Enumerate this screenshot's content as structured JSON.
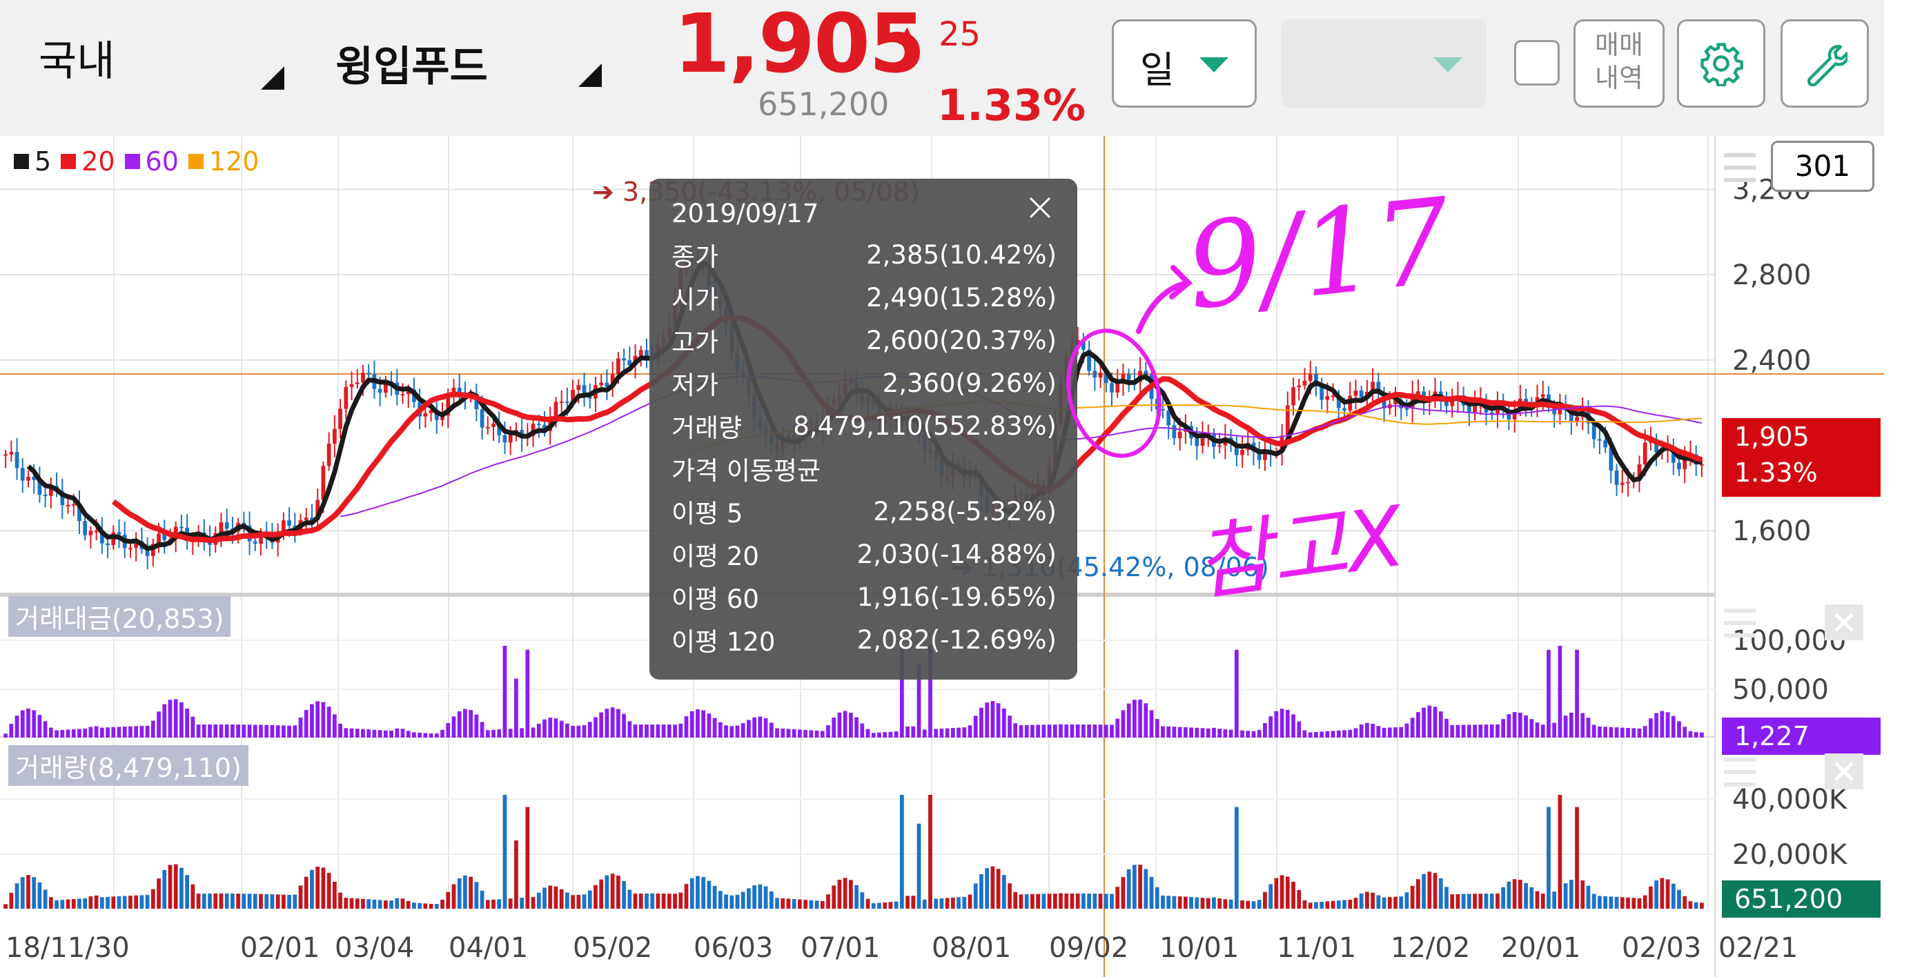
{
  "header": {
    "market": "국내",
    "stock_name": "윙입푸드",
    "price": "1,905",
    "change_arrow": "▲",
    "change": "25",
    "volume": "651,200",
    "change_pct": "1.33%",
    "period_label": "일",
    "trade_history_line1": "매매",
    "trade_history_line2": "내역",
    "count_box": "301"
  },
  "colors": {
    "up": "#e01a22",
    "down": "#1a73c8",
    "ma5": "#1a1a1a",
    "ma20": "#e8191f",
    "ma60": "#a020f0",
    "ma120": "#f5a000",
    "accent_green": "#1aa27f",
    "annotation": "#e81ff2",
    "amount_bar": "#8a1df2",
    "volume_tag": "#0b7a5a"
  },
  "legend": [
    {
      "label": "5",
      "color": "#1a1a1a"
    },
    {
      "label": "20",
      "color": "#e8191f"
    },
    {
      "label": "60",
      "color": "#a020f0"
    },
    {
      "label": "120",
      "color": "#f5a000"
    }
  ],
  "chart_data": {
    "type": "candlestick",
    "x_ticks": [
      "18/11/30",
      "02/01",
      "03/04",
      "04/01",
      "05/02",
      "06/03",
      "07/01",
      "08/01",
      "09/02",
      "10/01",
      "11/01",
      "12/02",
      "20/01",
      "02/03",
      "02/21"
    ],
    "y_ticks": [
      "3,200",
      "2,800",
      "2,400",
      "1,600"
    ],
    "ylim": [
      1300,
      3450
    ],
    "grid": true,
    "ma_lines": [
      "5",
      "20",
      "60",
      "120"
    ],
    "high_marker": "➔ 3,350(-43.13%, 05/08)",
    "low_marker": "➔ 1,310(45.42%, 08/06)",
    "current_price": "1,905",
    "current_pct": "1.33%",
    "approx_close_series": [
      1930,
      1850,
      1750,
      1650,
      1550,
      1520,
      1560,
      1570,
      1590,
      1600,
      1580,
      1590,
      1650,
      2100,
      2350,
      2280,
      2200,
      2150,
      2250,
      2120,
      2000,
      2100,
      2200,
      2250,
      2350,
      2400,
      2500,
      2900,
      2750,
      2300,
      2050,
      2000,
      2100,
      2280,
      2200,
      2150,
      2050,
      1900,
      1850,
      1700,
      1720,
      1800,
      2500,
      2330,
      2300,
      2300,
      2100,
      2000,
      2050,
      1950,
      1950,
      2300,
      2250,
      2200,
      2250,
      2200,
      2200,
      2250,
      2150,
      2180,
      2180,
      2200,
      2150,
      2000,
      1800,
      2000,
      1950,
      1905
    ]
  },
  "tooltip": {
    "date": "2019/09/17",
    "rows": [
      {
        "label": "종가",
        "value": "2,385(10.42%)"
      },
      {
        "label": "시가",
        "value": "2,490(15.28%)"
      },
      {
        "label": "고가",
        "value": "2,600(20.37%)"
      },
      {
        "label": "저가",
        "value": "2,360(9.26%)"
      },
      {
        "label": "거래량",
        "value": "8,479,110(552.83%)"
      },
      {
        "label": "가격 이동평균",
        "value": ""
      },
      {
        "label": "이평 5",
        "value": "2,258(-5.32%)"
      },
      {
        "label": "이평 20",
        "value": "2,030(-14.88%)"
      },
      {
        "label": "이평 60",
        "value": "1,916(-19.65%)"
      },
      {
        "label": "이평 120",
        "value": "2,082(-12.69%)"
      }
    ]
  },
  "amount_panel": {
    "title": "거래대금(20,853)",
    "y_ticks": [
      "100,000",
      "50,000"
    ],
    "current": "1,227"
  },
  "volume_panel": {
    "title": "거래량(8,479,110)",
    "y_ticks": [
      "40,000K",
      "20,000K"
    ],
    "current": "651,200"
  },
  "annotations": {
    "date_note": "9/17",
    "note": "참고X"
  }
}
